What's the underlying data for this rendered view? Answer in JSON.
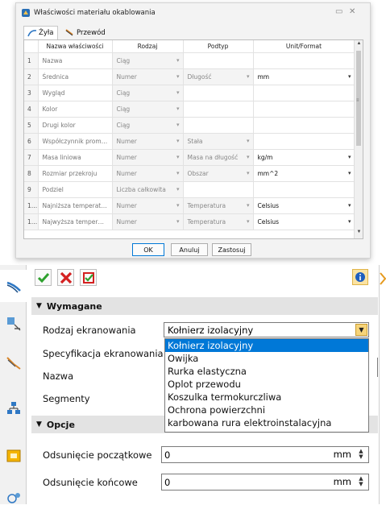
{
  "dialog": {
    "title": "Właściwości materiału okablowania",
    "tabs": [
      {
        "label": "Żyła",
        "active": true
      },
      {
        "label": "Przewód",
        "active": false
      }
    ],
    "columns": [
      "Nazwa właściwości",
      "Rodzaj",
      "Podtyp",
      "Unit/Format"
    ],
    "rows": [
      {
        "n": "1",
        "name": "Nazwa",
        "type": "Ciąg",
        "subtype": "",
        "unit": ""
      },
      {
        "n": "2",
        "name": "Średnica",
        "type": "Numer",
        "subtype": "Długość",
        "unit": "mm"
      },
      {
        "n": "3",
        "name": "Wygląd",
        "type": "Ciąg",
        "subtype": "",
        "unit": ""
      },
      {
        "n": "4",
        "name": "Kolor",
        "type": "Ciąg",
        "subtype": "",
        "unit": ""
      },
      {
        "n": "5",
        "name": "Drugi kolor",
        "type": "Ciąg",
        "subtype": "",
        "unit": ""
      },
      {
        "n": "6",
        "name": "Współczynnik promi...",
        "type": "Numer",
        "subtype": "Stała",
        "unit": ""
      },
      {
        "n": "7",
        "name": "Masa liniowa",
        "type": "Numer",
        "subtype": "Masa na długość",
        "unit": "kg/m"
      },
      {
        "n": "8",
        "name": "Rozmiar przekroju",
        "type": "Numer",
        "subtype": "Obszar",
        "unit": "mm^2"
      },
      {
        "n": "9",
        "name": "Podziel",
        "type": "Liczba całkowita",
        "subtype": "",
        "unit": ""
      },
      {
        "n": "10",
        "name": "Najniższa temperatura",
        "type": "Numer",
        "subtype": "Temperatura",
        "unit": "Celsius"
      },
      {
        "n": "11",
        "name": "Najwyższa temperat...",
        "type": "Numer",
        "subtype": "Temperatura",
        "unit": "Celsius"
      }
    ],
    "buttons": {
      "ok": "OK",
      "cancel": "Anuluj",
      "apply": "Zastosuj"
    }
  },
  "panel": {
    "section_required": "Wymagane",
    "section_options": "Opcje",
    "labels": {
      "shield_type": "Rodzaj ekranowania",
      "shield_spec": "Specyfikacja ekranowania",
      "name": "Nazwa",
      "segments": "Segmenty",
      "start_offset": "Odsunięcie początkowe",
      "end_offset": "Odsunięcie końcowe"
    },
    "shield_type_value": "Kołnierz izolacyjny",
    "dropdown_options": [
      "Kołnierz izolacyjny",
      "Owijka",
      "Rurka elastyczna",
      "Oplot przewodu",
      "Koszulka termokurczliwa",
      "Ochrona powierzchni",
      "karbowana rura elektroinstalacyjna"
    ],
    "start_offset": {
      "value": "0",
      "unit": "mm"
    },
    "end_offset": {
      "value": "0",
      "unit": "mm"
    }
  }
}
